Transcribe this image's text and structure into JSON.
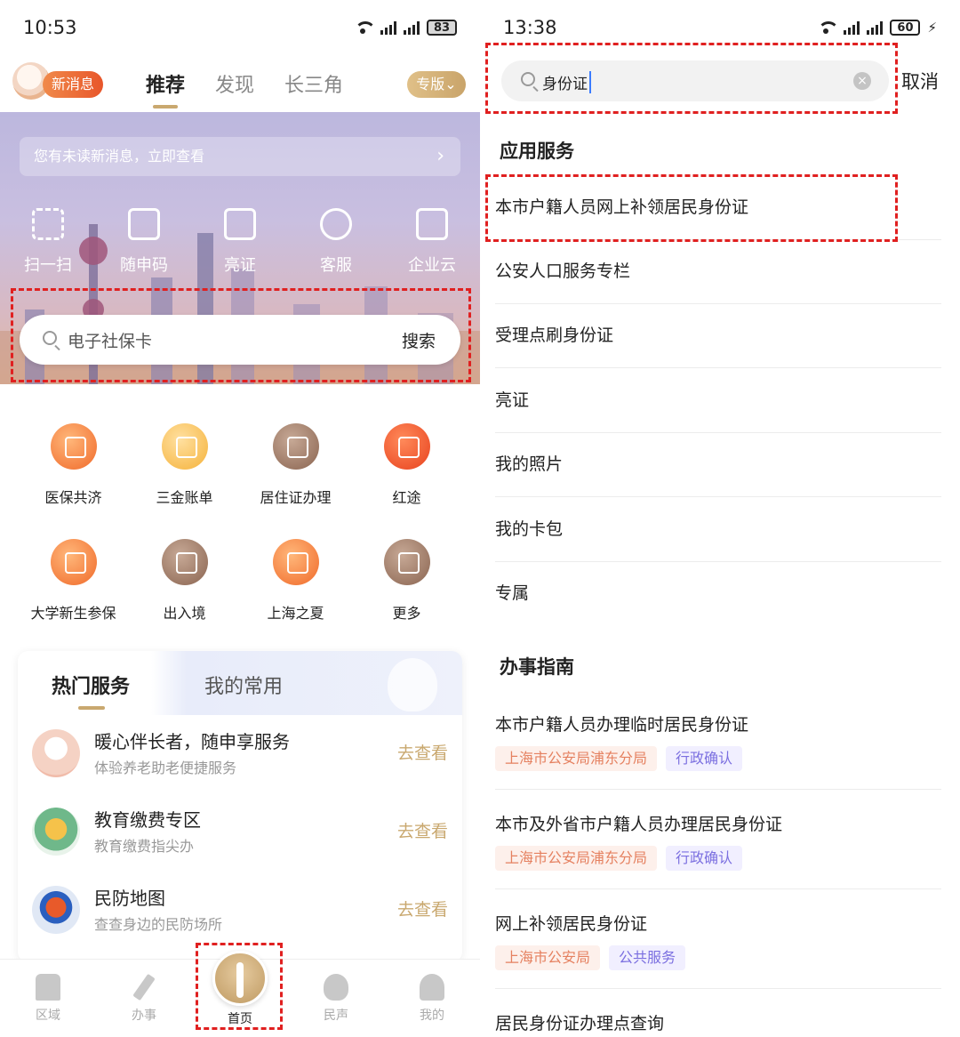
{
  "left": {
    "status": {
      "time": "10:53",
      "battery": "83"
    },
    "header": {
      "new_message": "新消息",
      "tabs": [
        "推荐",
        "发现",
        "长三角"
      ],
      "edition": "专版"
    },
    "banner": {
      "notice": "您有未读新消息，立即查看",
      "quick_actions": [
        "扫一扫",
        "随申码",
        "亮证",
        "客服",
        "企业云"
      ],
      "search_placeholder": "电子社保卡",
      "search_button": "搜索"
    },
    "services": [
      {
        "label": "医保共济",
        "icon": "family-icon"
      },
      {
        "label": "三金账单",
        "icon": "money-icon"
      },
      {
        "label": "居住证办理",
        "icon": "residence-card-icon"
      },
      {
        "label": "红途",
        "icon": "red-star-icon"
      },
      {
        "label": "大学新生参保",
        "icon": "student-insurance-icon"
      },
      {
        "label": "出入境",
        "icon": "airplane-icon"
      },
      {
        "label": "上海之夏",
        "icon": "shopping-cart-icon"
      },
      {
        "label": "更多",
        "icon": "more-grid-icon"
      }
    ],
    "hot": {
      "tab_active": "热门服务",
      "tab_other": "我的常用",
      "items": [
        {
          "title": "暖心伴长者，随申享服务",
          "subtitle": "体验养老助老便捷服务",
          "action": "去查看"
        },
        {
          "title": "教育缴费专区",
          "subtitle": "教育缴费指尖办",
          "action": "去查看"
        },
        {
          "title": "民防地图",
          "subtitle": "查查身边的民防场所",
          "action": "去查看"
        }
      ]
    },
    "bottom_nav": [
      "区域",
      "办事",
      "首页",
      "民声",
      "我的"
    ]
  },
  "right": {
    "status": {
      "time": "13:38",
      "battery": "60"
    },
    "search_value": "身份证",
    "cancel": "取消",
    "app_services_title": "应用服务",
    "app_services": [
      "本市户籍人员网上补领居民身份证",
      "公安人口服务专栏",
      "受理点刷身份证",
      "亮证",
      "我的照片",
      "我的卡包",
      "专属"
    ],
    "guide_title": "办事指南",
    "guides": [
      {
        "title": "本市户籍人员办理临时居民身份证",
        "org": "上海市公安局浦东分局",
        "kind": "行政确认"
      },
      {
        "title": "本市及外省市户籍人员办理居民身份证",
        "org": "上海市公安局浦东分局",
        "kind": "行政确认"
      },
      {
        "title": "网上补领居民身份证",
        "org": "上海市公安局",
        "kind": "公共服务"
      },
      {
        "title": "居民身份证办理点查询",
        "org": "",
        "kind": ""
      }
    ]
  },
  "colors": {
    "accent_gold": "#c9a86f",
    "highlight_red": "#e02020",
    "brand_orange": "#f06a2a"
  }
}
